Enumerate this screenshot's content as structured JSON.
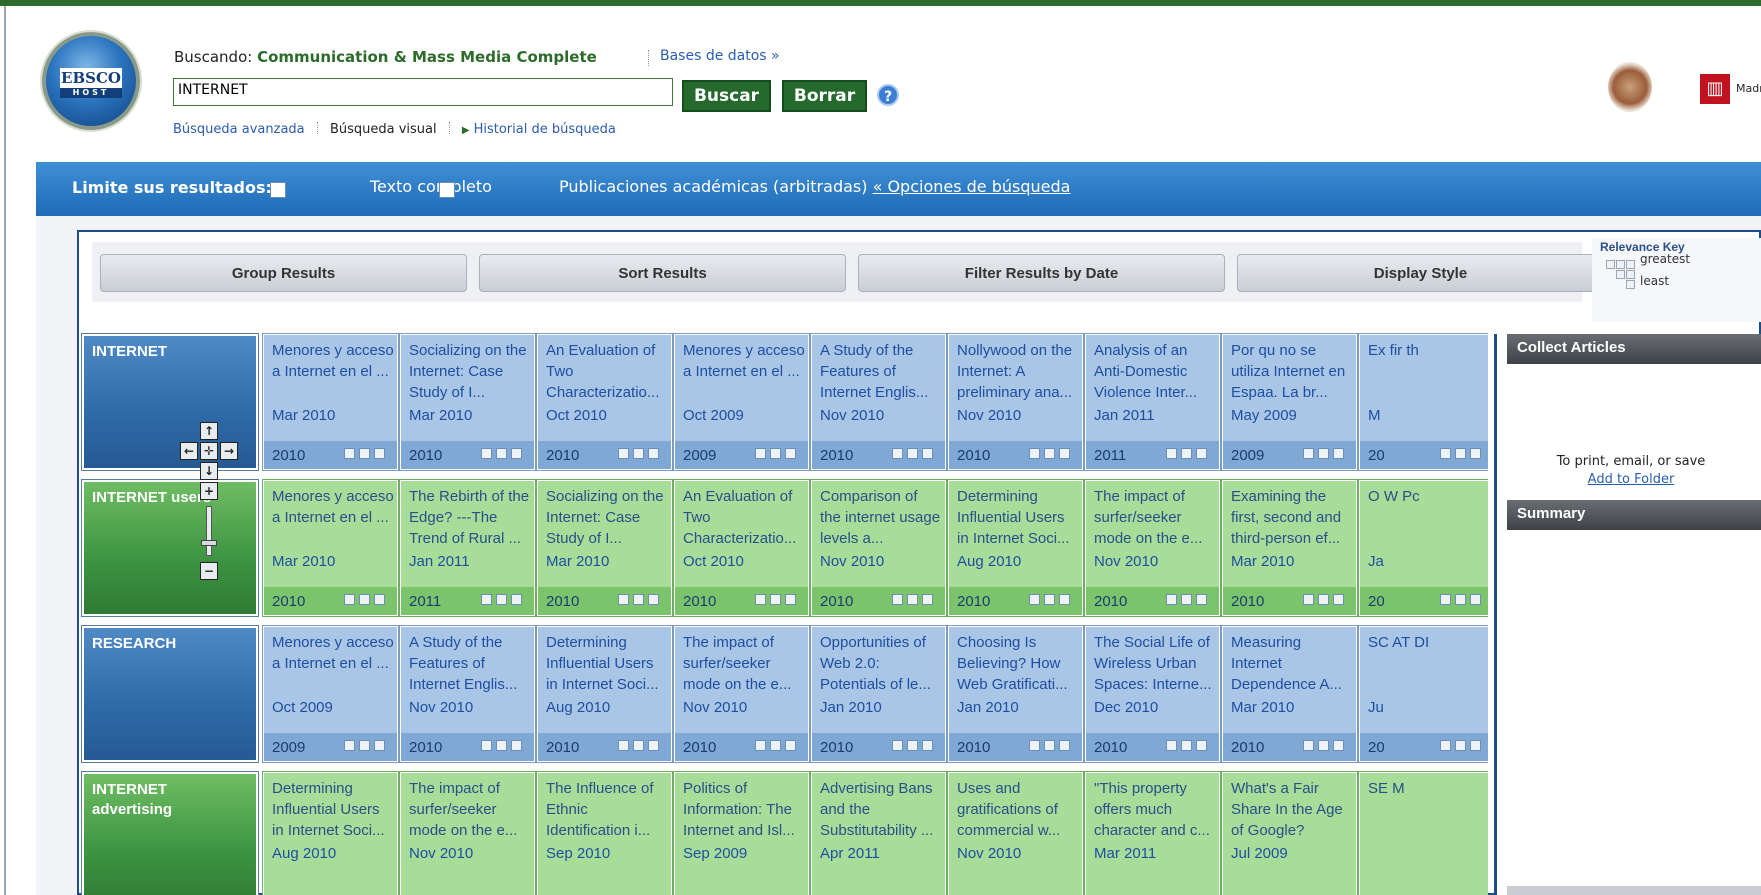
{
  "header": {
    "searching_label": "Buscando:",
    "database": "Communication & Mass Media Complete",
    "databases_link": "Bases de datos »",
    "search_value": "INTERNET",
    "search_button": "Buscar",
    "clear_button": "Borrar",
    "help": "?",
    "links": {
      "advanced": "Búsqueda avanzada",
      "visual": "Búsqueda visual",
      "history": "Historial de búsqueda"
    },
    "logo_text": "EBSCO",
    "logo_sub": "HOST",
    "madrid_text": "Madrid"
  },
  "limits": {
    "label": "Limite sus resultados:",
    "full_text": "Texto completo",
    "academic": "Publicaciones académicas (arbitradas)",
    "options_link": "« Opciones de búsqueda"
  },
  "toolbar": {
    "group": "Group Results",
    "sort": "Sort Results",
    "filter": "Filter Results by Date",
    "display": "Display Style"
  },
  "relevance": {
    "title": "Relevance Key",
    "greatest": "greatest",
    "least": "least"
  },
  "panels": {
    "collect": "Collect Articles",
    "print_text": "To print, email, or save",
    "add_folder": "Add to Folder",
    "summary": "Summary"
  },
  "rows": [
    {
      "label": "INTERNET",
      "color": "blue",
      "cells": [
        {
          "title": "Menores y acceso a Internet en el ...",
          "date": "Mar 2010",
          "year": "2010"
        },
        {
          "title": "Socializing on the Internet: Case Study of I...",
          "date": "Mar 2010",
          "year": "2010"
        },
        {
          "title": "An Evaluation of Two Characterizatio...",
          "date": "Oct 2010",
          "year": "2010"
        },
        {
          "title": "Menores y acceso a Internet en el ...",
          "date": "Oct 2009",
          "year": "2009"
        },
        {
          "title": "A Study of the Features of Internet Englis...",
          "date": "Nov 2010",
          "year": "2010"
        },
        {
          "title": "Nollywood on the Internet: A preliminary ana...",
          "date": "Nov 2010",
          "year": "2010"
        },
        {
          "title": "Analysis of an Anti-Domestic Violence Inter...",
          "date": "Jan 2011",
          "year": "2011"
        },
        {
          "title": "Por qu no se utiliza Internet en Espaa. La br...",
          "date": "May 2009",
          "year": "2009"
        },
        {
          "title": "Ex fir th",
          "date": "M",
          "year": "20"
        }
      ]
    },
    {
      "label": "INTERNET users",
      "color": "green",
      "cells": [
        {
          "title": "Menores y acceso a Internet en el ...",
          "date": "Mar 2010",
          "year": "2010"
        },
        {
          "title": "The Rebirth of the Edge? ---The Trend of Rural ...",
          "date": "Jan 2011",
          "year": "2011"
        },
        {
          "title": "Socializing on the Internet: Case Study of I...",
          "date": "Mar 2010",
          "year": "2010"
        },
        {
          "title": "An Evaluation of Two Characterizatio...",
          "date": "Oct 2010",
          "year": "2010"
        },
        {
          "title": "Comparison of the internet usage levels a...",
          "date": "Nov 2010",
          "year": "2010"
        },
        {
          "title": "Determining Influential Users in Internet Soci...",
          "date": "Aug 2010",
          "year": "2010"
        },
        {
          "title": "The impact of surfer/seeker mode on the e...",
          "date": "Nov 2010",
          "year": "2010"
        },
        {
          "title": "Examining the first, second and third-person ef...",
          "date": "Mar 2010",
          "year": "2010"
        },
        {
          "title": "O W Pc",
          "date": "Ja",
          "year": "20"
        }
      ]
    },
    {
      "label": "RESEARCH",
      "color": "blue",
      "cells": [
        {
          "title": "Menores y acceso a Internet en el ...",
          "date": "Oct 2009",
          "year": "2009"
        },
        {
          "title": "A Study of the Features of Internet Englis...",
          "date": "Nov 2010",
          "year": "2010"
        },
        {
          "title": "Determining Influential Users in Internet Soci...",
          "date": "Aug 2010",
          "year": "2010"
        },
        {
          "title": "The impact of surfer/seeker mode on the e...",
          "date": "Nov 2010",
          "year": "2010"
        },
        {
          "title": "Opportunities of Web 2.0: Potentials of le...",
          "date": "Jan 2010",
          "year": "2010"
        },
        {
          "title": "Choosing Is Believing? How Web Gratificati...",
          "date": "Jan 2010",
          "year": "2010"
        },
        {
          "title": "The Social Life of Wireless Urban Spaces: Interne...",
          "date": "Dec 2010",
          "year": "2010"
        },
        {
          "title": "Measuring Internet Dependence A...",
          "date": "Mar 2010",
          "year": "2010"
        },
        {
          "title": "SC AT DI",
          "date": "Ju",
          "year": "20"
        }
      ]
    },
    {
      "label": "INTERNET advertising",
      "color": "green",
      "cells": [
        {
          "title": "Determining Influential Users in Internet Soci...",
          "date": "Aug 2010",
          "year": "2010"
        },
        {
          "title": "The impact of surfer/seeker mode on the e...",
          "date": "Nov 2010",
          "year": "2010"
        },
        {
          "title": "The Influence of Ethnic Identification i...",
          "date": "Sep 2010",
          "year": "2010"
        },
        {
          "title": "Politics of Information: The Internet and Isl...",
          "date": "Sep 2009",
          "year": "2009"
        },
        {
          "title": "Advertising Bans and the Substitutability ...",
          "date": "Apr 2011",
          "year": "2011"
        },
        {
          "title": "Uses and gratifications of commercial w...",
          "date": "Nov 2010",
          "year": "2010"
        },
        {
          "title": "\"This property offers much character and c...",
          "date": "Mar 2011",
          "year": "2011"
        },
        {
          "title": "What's a Fair Share In the Age of Google?",
          "date": "Jul 2009",
          "year": "2009"
        },
        {
          "title": "SE M",
          "date": "",
          "year": ""
        }
      ]
    }
  ],
  "zoom_controls": {
    "up": "↑",
    "left": "←",
    "center": "✛",
    "right": "→",
    "down": "↓",
    "plus": "+",
    "minus": "−"
  },
  "colors": {
    "accent_green": "#25692d",
    "accent_blue": "#1f6bb6"
  }
}
